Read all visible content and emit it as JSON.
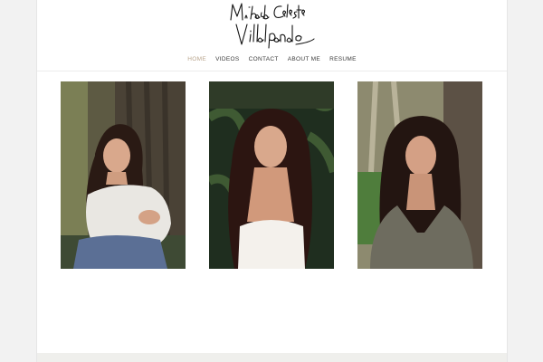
{
  "site": {
    "logo_text": "Mikaela Celeste Villalpando"
  },
  "nav": {
    "items": [
      {
        "label": "HOME",
        "active": true
      },
      {
        "label": "VIDEOS",
        "active": false
      },
      {
        "label": "CONTACT",
        "active": false
      },
      {
        "label": "ABOUT ME",
        "active": false
      },
      {
        "label": "RESUME",
        "active": false
      }
    ]
  },
  "gallery": {
    "photos": [
      {
        "subject": "portrait-seated-white-sweater"
      },
      {
        "subject": "portrait-white-top-foliage"
      },
      {
        "subject": "portrait-gray-blazer-trees"
      }
    ]
  },
  "colors": {
    "accent": "#b9a48c",
    "nav_text": "#3a3a3a",
    "background": "#ffffff"
  }
}
